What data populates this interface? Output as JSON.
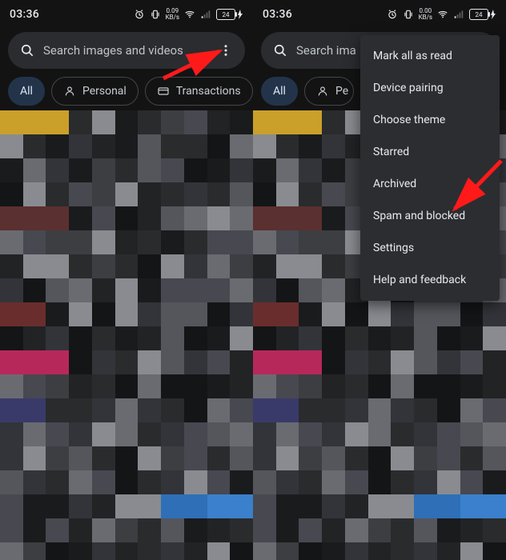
{
  "status": {
    "time": "03:36",
    "kbs_top": "0.09",
    "kbs_bottom": "KB/s",
    "battery": "24"
  },
  "search": {
    "placeholder": "Search images and videos",
    "placeholder_cut": "Search ima"
  },
  "chips": {
    "all": "All",
    "personal": "Personal",
    "transactions": "Transactions",
    "personal_cut": "Pe"
  },
  "menu": {
    "items": [
      "Mark all as read",
      "Device pairing",
      "Choose theme",
      "Starred",
      "Archived",
      "Spam and blocked",
      "Settings",
      "Help and feedback"
    ]
  }
}
